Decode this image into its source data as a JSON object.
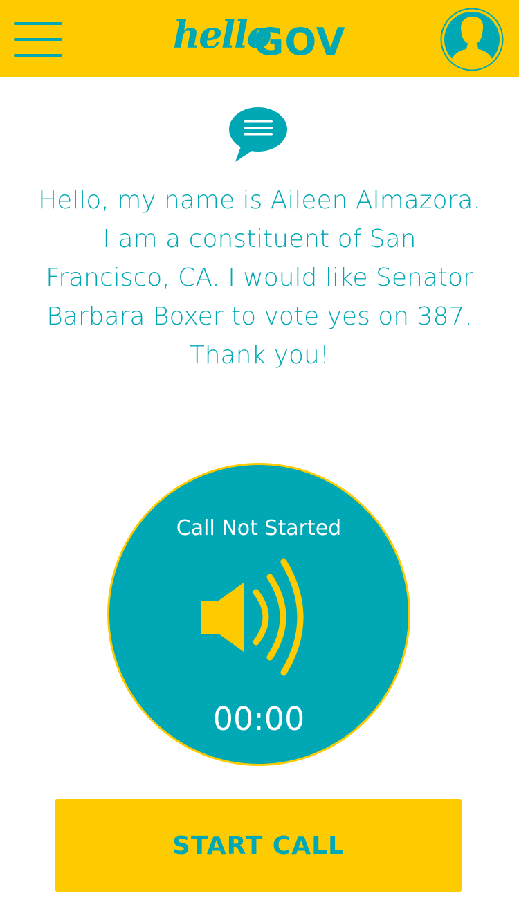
{
  "header": {
    "menu_icon": "hamburger-menu-icon",
    "logo": {
      "part1": "hello",
      "part2": "GOV"
    },
    "avatar_icon": "user-avatar-icon"
  },
  "message": {
    "icon": "speech-bubble-icon",
    "text": "Hello, my name is Aileen Almazora. I am a constituent of San Francisco, CA. I would like Senator Barbara Boxer to vote yes on 387. Thank you!"
  },
  "call": {
    "status": "Call Not Started",
    "icon": "speaker-icon",
    "timer": "00:00"
  },
  "actions": {
    "start_call_label": "START CALL"
  },
  "colors": {
    "brand_yellow": "#fecb00",
    "brand_teal": "#00a8b5",
    "background": "#ffffff"
  }
}
